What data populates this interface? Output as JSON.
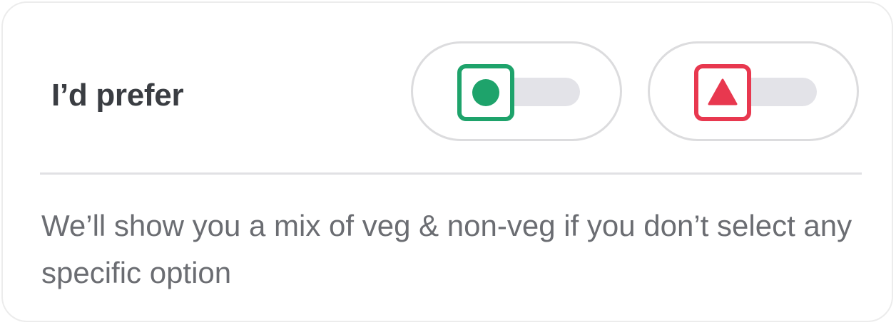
{
  "preference": {
    "title": "I’d prefer",
    "hint": "We’ll show you a mix of veg & non-veg if you don’t select any specific option"
  },
  "toggles": [
    {
      "name": "veg",
      "icon": "veg-dot-icon",
      "color": "#1ea36b",
      "on": false
    },
    {
      "name": "non-veg",
      "icon": "non-veg-triangle-icon",
      "color": "#e8384f",
      "on": false
    }
  ],
  "colors": {
    "title": "#3a3d42",
    "hint": "#6b6d72",
    "track": "#e3e3e8",
    "border": "#dcdcde"
  }
}
